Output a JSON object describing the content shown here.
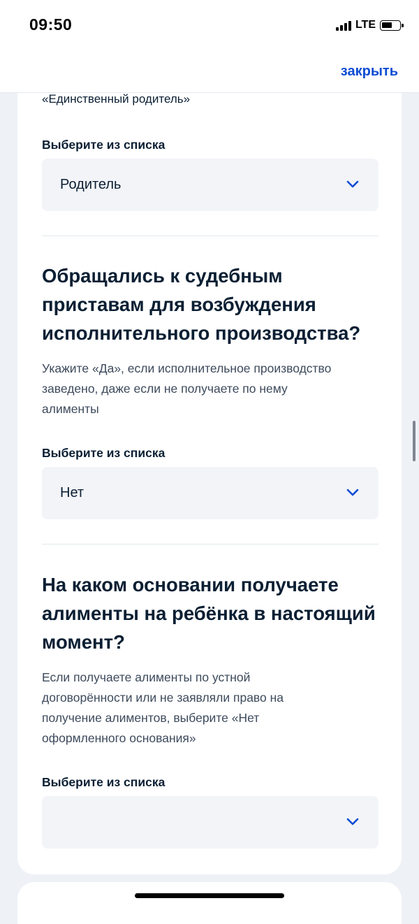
{
  "status_bar": {
    "time": "09:50",
    "network": "LTE"
  },
  "nav": {
    "close_label": "закрыть"
  },
  "form": {
    "prev_option_text": "«Единственный родитель»",
    "select_label": "Выберите из списка",
    "q1": {
      "select_value": "Родитель"
    },
    "q2": {
      "question_lines": [
        "Обращались к судебным",
        "приставам для возбуждения",
        "исполнительного производства?"
      ],
      "hint_lines": [
        "Укажите «Да», если исполнительное производство",
        "заведено, даже если не получаете по нему",
        "алименты"
      ],
      "select_value": "Нет"
    },
    "q3": {
      "question_lines": [
        "На каком основании получаете",
        "алименты на ребёнка в настоящий",
        "момент?"
      ],
      "hint_lines": [
        "Если получаете алименты по устной",
        "договорённости или не заявляли право на",
        "получение алиментов, выберите «Нет",
        "оформленного основания»"
      ],
      "select_value": ""
    }
  },
  "icons": {
    "select_chevron": "chevron-down-icon"
  },
  "colors": {
    "accent": "#0d4cd3",
    "text": "#0b1f33",
    "hint": "#3d4a5c",
    "field_bg": "#f2f4f8"
  }
}
